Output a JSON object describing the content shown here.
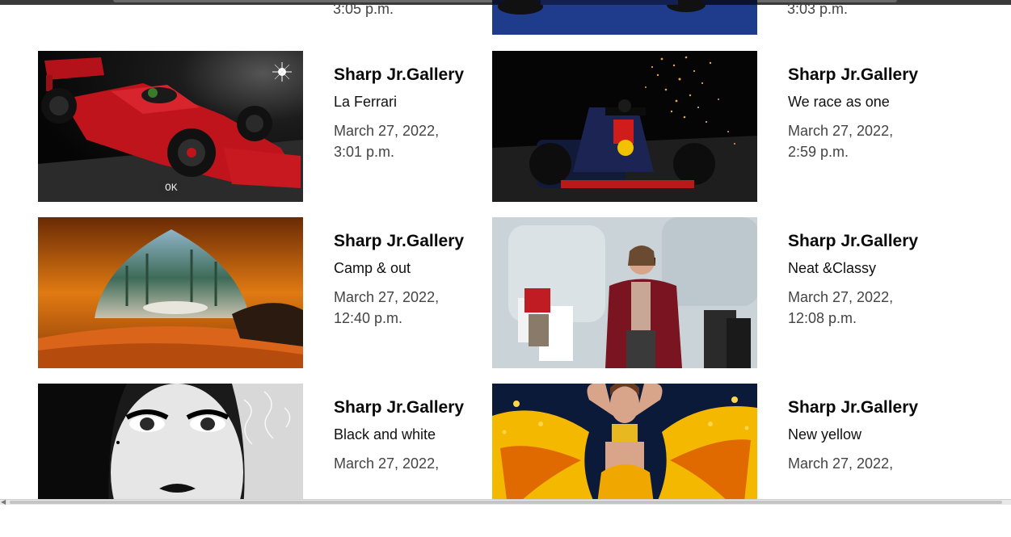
{
  "top_row": {
    "left_time": "3:05 p.m.",
    "right_time": "3:03 p.m."
  },
  "cards": [
    {
      "author": "Sharp Jr.Gallery",
      "caption": "La Ferrari",
      "date_line1": "March 27, 2022,",
      "date_line2": "3:01 p.m.",
      "image": "red-ferrari-f1-car",
      "watermark": "OK"
    },
    {
      "author": "Sharp Jr.Gallery",
      "caption": "We race as one",
      "date_line1": "March 27, 2022,",
      "date_line2": "2:59 p.m.",
      "image": "red-bull-f1-car-sparks"
    },
    {
      "author": "Sharp Jr.Gallery",
      "caption": "Camp & out",
      "date_line1": "March 27, 2022,",
      "date_line2": "12:40 p.m.",
      "image": "tent-forest-view"
    },
    {
      "author": "Sharp Jr.Gallery",
      "caption": "Neat &Classy",
      "date_line1": "March 27, 2022,",
      "date_line2": "12:08 p.m.",
      "image": "woman-shopping-bags"
    },
    {
      "author": "Sharp Jr.Gallery",
      "caption": "Black and white",
      "date_line1": "March 27, 2022,",
      "date_line2": "",
      "image": "bw-portrait-woman"
    },
    {
      "author": "Sharp Jr.Gallery",
      "caption": "New yellow",
      "date_line1": "March 27, 2022,",
      "date_line2": "",
      "image": "woman-yellow-splash"
    }
  ],
  "colors": {
    "author_text": "#0a0a0a",
    "date_text": "#444444",
    "ferrari_red": "#c0141c",
    "tent_orange": "#e07a12",
    "splash_yellow": "#f5b800"
  }
}
